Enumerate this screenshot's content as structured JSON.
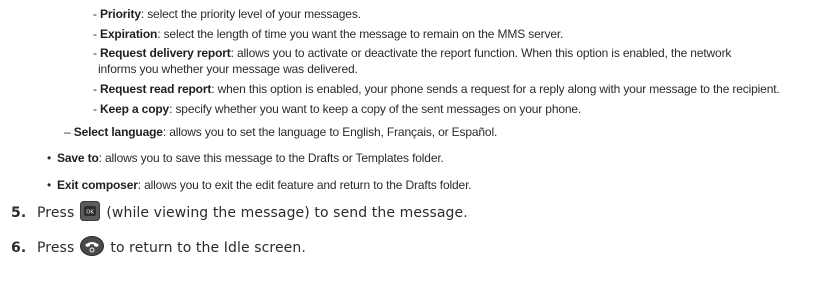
{
  "sub_items": [
    {
      "prefix": "- ",
      "term": "Priority",
      "text": ": select the priority level of your messages."
    },
    {
      "prefix": "- ",
      "term": "Expiration",
      "text": ": select the length of time you want the message to remain on the MMS server."
    },
    {
      "prefix": "- ",
      "term": "Request delivery report",
      "text": ": allows you to activate or deactivate the report function. When this option is enabled, the network"
    },
    {
      "prefix": "",
      "term": "",
      "text": "informs you whether your message was delivered."
    },
    {
      "prefix": "- ",
      "term": "Request read report",
      "text": ": when this option is enabled, your phone sends a request for a reply along with your message to the recipient."
    },
    {
      "prefix": "- ",
      "term": "Keep a copy",
      "text": ": specify whether you want to keep a copy of the sent messages on your phone."
    }
  ],
  "dash_item": {
    "prefix": "– ",
    "term": "Select language",
    "text": ": allows you to set the language to English, Français, or Español."
  },
  "bullets": [
    {
      "marker": "•",
      "term": "Save to",
      "text": ": allows you to save this message to the Drafts or Templates folder."
    },
    {
      "marker": "•",
      "term": "Exit composer",
      "text": ": allows you to exit the edit feature and return to the Drafts folder."
    }
  ],
  "steps": [
    {
      "num": "5.",
      "before": "Press",
      "icon": "ok-key-icon",
      "after": "(while viewing the message) to send the message."
    },
    {
      "num": "6.",
      "before": "Press",
      "icon": "end-key-icon",
      "after": "to return to the Idle screen."
    }
  ]
}
